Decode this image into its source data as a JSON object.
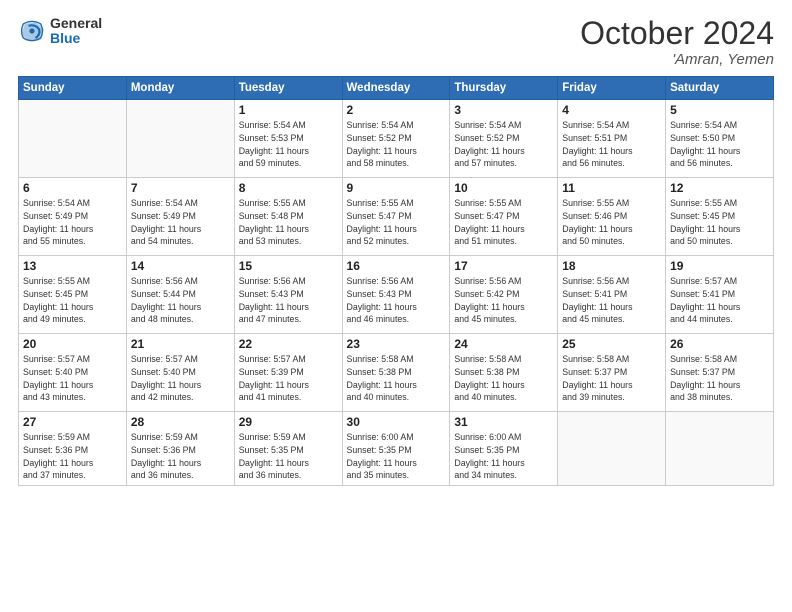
{
  "logo": {
    "general": "General",
    "blue": "Blue"
  },
  "title": "October 2024",
  "location": "'Amran, Yemen",
  "days_of_week": [
    "Sunday",
    "Monday",
    "Tuesday",
    "Wednesday",
    "Thursday",
    "Friday",
    "Saturday"
  ],
  "weeks": [
    [
      {
        "day": "",
        "info": ""
      },
      {
        "day": "",
        "info": ""
      },
      {
        "day": "1",
        "info": "Sunrise: 5:54 AM\nSunset: 5:53 PM\nDaylight: 11 hours\nand 59 minutes."
      },
      {
        "day": "2",
        "info": "Sunrise: 5:54 AM\nSunset: 5:52 PM\nDaylight: 11 hours\nand 58 minutes."
      },
      {
        "day": "3",
        "info": "Sunrise: 5:54 AM\nSunset: 5:52 PM\nDaylight: 11 hours\nand 57 minutes."
      },
      {
        "day": "4",
        "info": "Sunrise: 5:54 AM\nSunset: 5:51 PM\nDaylight: 11 hours\nand 56 minutes."
      },
      {
        "day": "5",
        "info": "Sunrise: 5:54 AM\nSunset: 5:50 PM\nDaylight: 11 hours\nand 56 minutes."
      }
    ],
    [
      {
        "day": "6",
        "info": "Sunrise: 5:54 AM\nSunset: 5:49 PM\nDaylight: 11 hours\nand 55 minutes."
      },
      {
        "day": "7",
        "info": "Sunrise: 5:54 AM\nSunset: 5:49 PM\nDaylight: 11 hours\nand 54 minutes."
      },
      {
        "day": "8",
        "info": "Sunrise: 5:55 AM\nSunset: 5:48 PM\nDaylight: 11 hours\nand 53 minutes."
      },
      {
        "day": "9",
        "info": "Sunrise: 5:55 AM\nSunset: 5:47 PM\nDaylight: 11 hours\nand 52 minutes."
      },
      {
        "day": "10",
        "info": "Sunrise: 5:55 AM\nSunset: 5:47 PM\nDaylight: 11 hours\nand 51 minutes."
      },
      {
        "day": "11",
        "info": "Sunrise: 5:55 AM\nSunset: 5:46 PM\nDaylight: 11 hours\nand 50 minutes."
      },
      {
        "day": "12",
        "info": "Sunrise: 5:55 AM\nSunset: 5:45 PM\nDaylight: 11 hours\nand 50 minutes."
      }
    ],
    [
      {
        "day": "13",
        "info": "Sunrise: 5:55 AM\nSunset: 5:45 PM\nDaylight: 11 hours\nand 49 minutes."
      },
      {
        "day": "14",
        "info": "Sunrise: 5:56 AM\nSunset: 5:44 PM\nDaylight: 11 hours\nand 48 minutes."
      },
      {
        "day": "15",
        "info": "Sunrise: 5:56 AM\nSunset: 5:43 PM\nDaylight: 11 hours\nand 47 minutes."
      },
      {
        "day": "16",
        "info": "Sunrise: 5:56 AM\nSunset: 5:43 PM\nDaylight: 11 hours\nand 46 minutes."
      },
      {
        "day": "17",
        "info": "Sunrise: 5:56 AM\nSunset: 5:42 PM\nDaylight: 11 hours\nand 45 minutes."
      },
      {
        "day": "18",
        "info": "Sunrise: 5:56 AM\nSunset: 5:41 PM\nDaylight: 11 hours\nand 45 minutes."
      },
      {
        "day": "19",
        "info": "Sunrise: 5:57 AM\nSunset: 5:41 PM\nDaylight: 11 hours\nand 44 minutes."
      }
    ],
    [
      {
        "day": "20",
        "info": "Sunrise: 5:57 AM\nSunset: 5:40 PM\nDaylight: 11 hours\nand 43 minutes."
      },
      {
        "day": "21",
        "info": "Sunrise: 5:57 AM\nSunset: 5:40 PM\nDaylight: 11 hours\nand 42 minutes."
      },
      {
        "day": "22",
        "info": "Sunrise: 5:57 AM\nSunset: 5:39 PM\nDaylight: 11 hours\nand 41 minutes."
      },
      {
        "day": "23",
        "info": "Sunrise: 5:58 AM\nSunset: 5:38 PM\nDaylight: 11 hours\nand 40 minutes."
      },
      {
        "day": "24",
        "info": "Sunrise: 5:58 AM\nSunset: 5:38 PM\nDaylight: 11 hours\nand 40 minutes."
      },
      {
        "day": "25",
        "info": "Sunrise: 5:58 AM\nSunset: 5:37 PM\nDaylight: 11 hours\nand 39 minutes."
      },
      {
        "day": "26",
        "info": "Sunrise: 5:58 AM\nSunset: 5:37 PM\nDaylight: 11 hours\nand 38 minutes."
      }
    ],
    [
      {
        "day": "27",
        "info": "Sunrise: 5:59 AM\nSunset: 5:36 PM\nDaylight: 11 hours\nand 37 minutes."
      },
      {
        "day": "28",
        "info": "Sunrise: 5:59 AM\nSunset: 5:36 PM\nDaylight: 11 hours\nand 36 minutes."
      },
      {
        "day": "29",
        "info": "Sunrise: 5:59 AM\nSunset: 5:35 PM\nDaylight: 11 hours\nand 36 minutes."
      },
      {
        "day": "30",
        "info": "Sunrise: 6:00 AM\nSunset: 5:35 PM\nDaylight: 11 hours\nand 35 minutes."
      },
      {
        "day": "31",
        "info": "Sunrise: 6:00 AM\nSunset: 5:35 PM\nDaylight: 11 hours\nand 34 minutes."
      },
      {
        "day": "",
        "info": ""
      },
      {
        "day": "",
        "info": ""
      }
    ]
  ]
}
